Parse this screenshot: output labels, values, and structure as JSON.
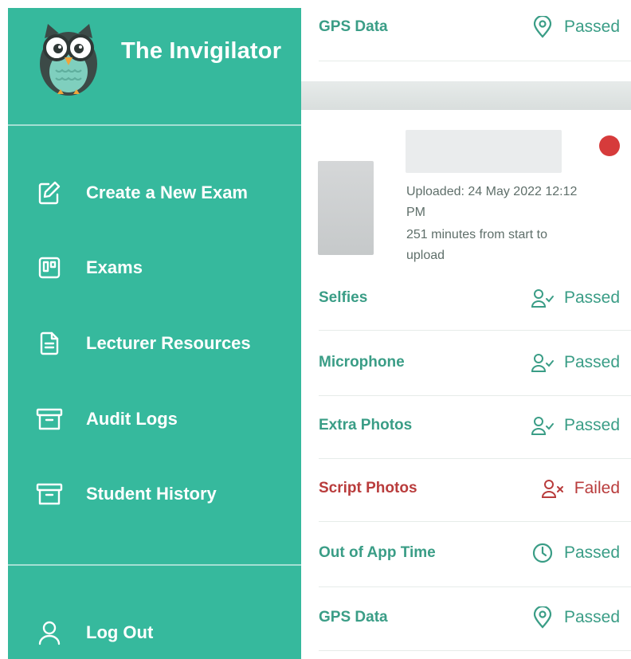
{
  "app": {
    "title": "The Invigilator"
  },
  "sidebar": {
    "items": [
      {
        "label": "Create a New Exam",
        "icon": "edit-icon"
      },
      {
        "label": "Exams",
        "icon": "board-icon"
      },
      {
        "label": "Lecturer Resources",
        "icon": "document-icon"
      },
      {
        "label": "Audit Logs",
        "icon": "archive-icon"
      },
      {
        "label": "Student History",
        "icon": "archive-icon"
      }
    ],
    "logout": {
      "label": "Log Out",
      "icon": "user-icon"
    }
  },
  "upload": {
    "uploaded_line1": "Uploaded: 24 May 2022 12:12",
    "uploaded_line2": "PM",
    "minutes_line1": "251 minutes from start to",
    "minutes_line2": "upload"
  },
  "checks_top": [
    {
      "label": "GPS Data",
      "status": "Passed",
      "icon": "location-pin-icon"
    }
  ],
  "checks": [
    {
      "label": "Selfies",
      "status": "Passed",
      "icon": "user-check-icon"
    },
    {
      "label": "Microphone",
      "status": "Passed",
      "icon": "user-check-icon"
    },
    {
      "label": "Extra Photos",
      "status": "Passed",
      "icon": "user-check-icon"
    },
    {
      "label": "Script Photos",
      "status": "Failed",
      "icon": "user-x-icon"
    },
    {
      "label": "Out of App Time",
      "status": "Passed",
      "icon": "clock-icon"
    },
    {
      "label": "GPS Data",
      "status": "Passed",
      "icon": "location-pin-icon"
    }
  ],
  "colors": {
    "sidebar": "#36b99d",
    "passed": "#3a9d86",
    "failed": "#b93c3c",
    "alert_dot": "#d63b3b"
  }
}
